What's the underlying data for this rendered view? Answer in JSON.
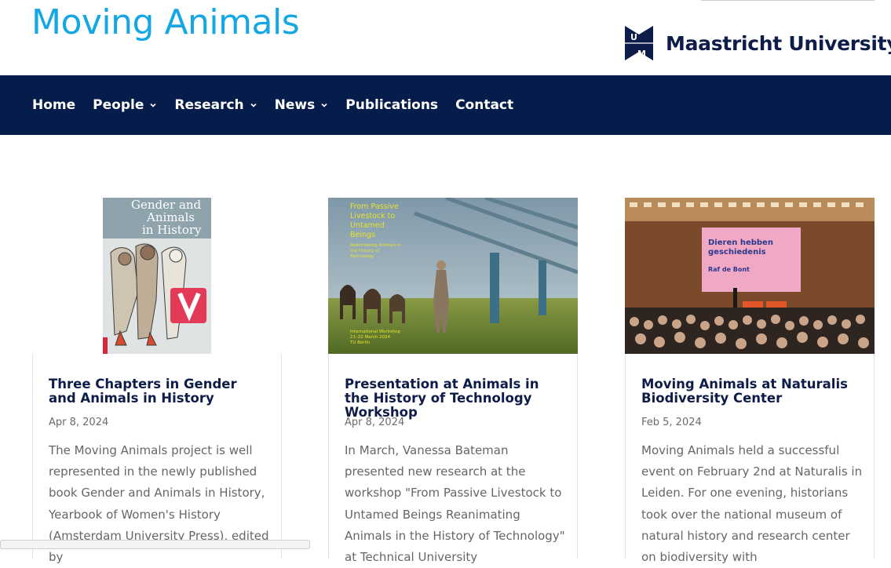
{
  "site": {
    "title": "Moving Animals",
    "logo_text": "Maastricht University",
    "logo_icon": "um-logo-icon"
  },
  "nav": {
    "items": [
      {
        "label": "Home",
        "has_dropdown": false
      },
      {
        "label": "People",
        "has_dropdown": true
      },
      {
        "label": "Research",
        "has_dropdown": true
      },
      {
        "label": "News",
        "has_dropdown": true
      },
      {
        "label": "Publications",
        "has_dropdown": false
      },
      {
        "label": "Contact",
        "has_dropdown": false
      }
    ]
  },
  "posts": [
    {
      "title": "Three Chapters in Gender and Animals in History",
      "date": "Apr 8, 2024",
      "excerpt": "The Moving Animals project is well represented in the newly published book Gender and Animals in History, Yearbook of Women's History (Amsterdam University Press), edited by",
      "image": {
        "kind": "book-cover",
        "cover_text_lines": [
          "Gender and",
          "Animals",
          "in History"
        ]
      }
    },
    {
      "title": "Presentation at Animals in the History of Technology Workshop",
      "date": "Apr 8, 2024",
      "excerpt": "In March, Vanessa Bateman presented new research at the workshop \"From Passive Livestock to Untamed Beings Reanimating Animals in the History of Technology\" at Technical University",
      "image": {
        "kind": "workshop-poster",
        "headline_lines": [
          "From Passive",
          "Livestock to",
          "Untamed",
          "Beings"
        ],
        "subline_lines": [
          "Reanimating Animals in",
          "the History of",
          "Technology"
        ],
        "footer_lines": [
          "International Workshop",
          "21–22 March 2024",
          "TU Berlin"
        ]
      }
    },
    {
      "title": "Moving Animals at Naturalis Biodiversity Center",
      "date": "Feb 5, 2024",
      "excerpt": "Moving Animals held a successful event on February 2nd at Naturalis in Leiden. For one evening, historians took over the national museum of natural history and research center on biodiversity with",
      "image": {
        "kind": "lecture-photo",
        "screen_title_lines": [
          "Dieren hebben",
          "geschiedenis"
        ],
        "screen_speaker": "Raf de Bont"
      }
    }
  ],
  "colors": {
    "title_blue": "#13a7e3",
    "nav_bg": "#061c4b",
    "heading_navy": "#0d1c49",
    "body_text": "#666666",
    "poster_yellow": "#e7e22c"
  }
}
